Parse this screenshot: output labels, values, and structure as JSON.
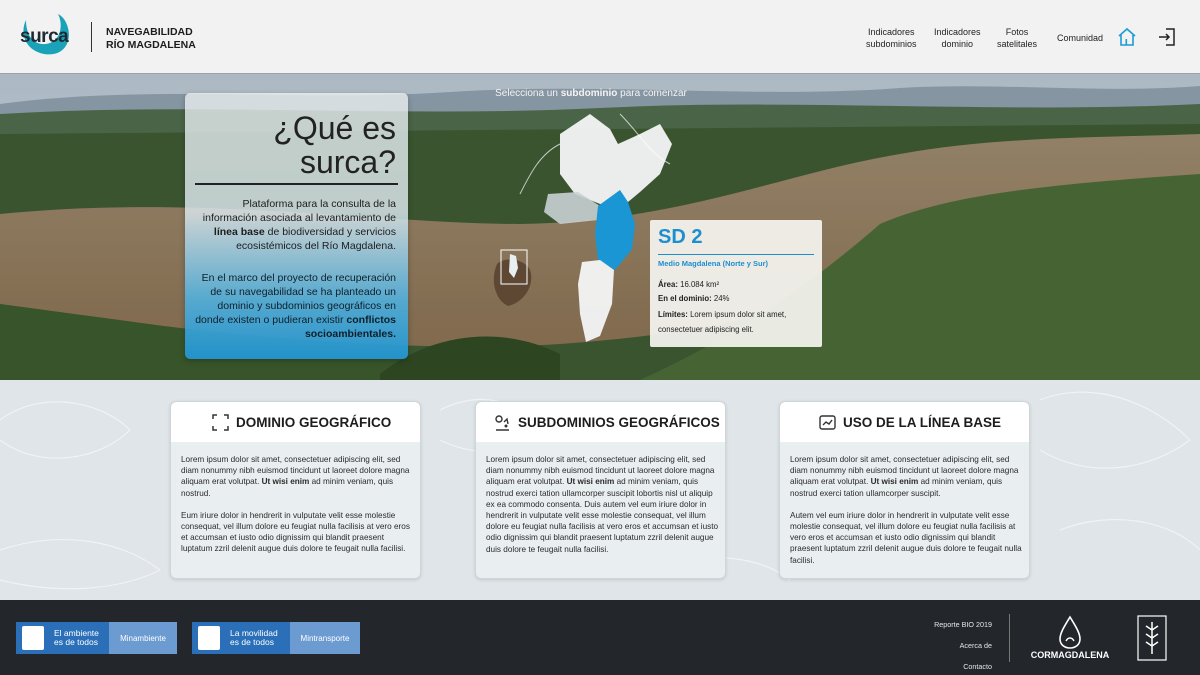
{
  "header": {
    "logo_text": "surca",
    "brand_line1": "NAVEGABILIDAD",
    "brand_line2": "RÍO MAGDALENA",
    "nav": [
      {
        "line1": "Indicadores",
        "line2": "subdominios"
      },
      {
        "line1": "Indicadores",
        "line2": "dominio"
      },
      {
        "line1": "Fotos",
        "line2": "satelitales"
      },
      {
        "line1": "Comunidad",
        "line2": ""
      }
    ],
    "home_icon": "home-icon",
    "login_icon": "login-icon"
  },
  "hero": {
    "prompt_pre": "Selecciona un ",
    "prompt_bold": "subdominio",
    "prompt_post": " para comenzar",
    "title_line1": "¿Qué es",
    "title_line2": "surca?",
    "p1_a": "Plataforma para la consulta de la información asociada al levantamiento de ",
    "p1_bold": "línea base",
    "p1_b": " de biodiversidad y servicios ecosistémicos del Río Magdalena.",
    "p2_a": "En el marco del proyecto de recuperación de su navegabilidad se ha planteado un dominio y subdominios geográficos en donde existen o pudieran existir ",
    "p2_bold": "conflictos socioambientales."
  },
  "subdomain_card": {
    "title": "SD 2",
    "name": "Medio Magdalena (Norte y Sur)",
    "area_label": "Área:",
    "area_value": " 16.084 km²",
    "domain_label": "En el dominio:",
    "domain_value": " 24%",
    "limits_label": "Límites:",
    "limits_value": " Lorem ipsum dolor sit amet, consectetuer adipiscing elit.",
    "accent": "#1b8fd0"
  },
  "cards": [
    {
      "title": "DOMINIO GEOGRÁFICO",
      "icon": "frame-icon",
      "p1_a": "Lorem ipsum dolor sit amet, consectetuer adipiscing elit, sed diam nonummy nibh euismod tincidunt ut laoreet dolore magna aliquam erat volutpat. ",
      "p1_bold": "Ut wisi enim",
      "p1_b": " ad minim veniam, quis nostrud.",
      "p2": "Eum iriure dolor in hendrerit in vulputate velit esse molestie consequat, vel illum dolore eu feugiat nulla facilisis at vero eros et accumsan et iusto odio dignissim qui blandit praesent luptatum zzril delenit augue duis dolore te feugait nulla facilisi."
    },
    {
      "title": "SUBDOMINIOS GEOGRÁFICOS",
      "icon": "map-pin-icon",
      "p1_a": "Lorem ipsum dolor sit amet, consectetuer adipiscing elit, sed diam nonummy nibh euismod tincidunt ut laoreet dolore magna aliquam erat volutpat. ",
      "p1_bold": "Ut wisi enim",
      "p1_b": " ad minim veniam, quis nostrud exerci tation ullamcorper suscipit lobortis nisl ut aliquip ex ea commodo consenta. Duis autem vel eum iriure dolor in hendrerit in vulputate velit esse molestie consequat, vel illum dolore eu feugiat nulla facilisis at vero eros et accumsan et iusto odio dignissim qui blandit praesent luptatum zzril delenit augue duis dolore te feugait nulla facilisi.",
      "p2": ""
    },
    {
      "title": "USO DE LA LÍNEA BASE",
      "icon": "chart-icon",
      "p1_a": "Lorem ipsum dolor sit amet, consectetuer adipiscing elit, sed diam nonummy nibh euismod tincidunt ut laoreet dolore magna aliquam erat volutpat. ",
      "p1_bold": "Ut wisi enim",
      "p1_b": " ad minim veniam, quis nostrud exerci tation ullamcorper suscipit.",
      "p2": "Autem vel eum iriure dolor in hendrerit in vulputate velit esse molestie consequat, vel illum dolore eu feugiat nulla facilisis at vero eros et accumsan et iusto odio dignissim qui blandit praesent luptatum zzril delenit augue duis dolore te feugait nulla facilisi."
    }
  ],
  "footer": {
    "gov1_line1": "El ambiente",
    "gov1_line2": "es de todos",
    "gov1_tag": "Minambiente",
    "gov2_line1": "La movilidad",
    "gov2_line2": "es de todos",
    "gov2_tag": "Mintransporte",
    "links": [
      "Reporte BIO 2019",
      "Acerca de",
      "Contacto"
    ],
    "cormagdalena": "CORMAGDALENA",
    "humboldt": "HUMBOLDT"
  }
}
